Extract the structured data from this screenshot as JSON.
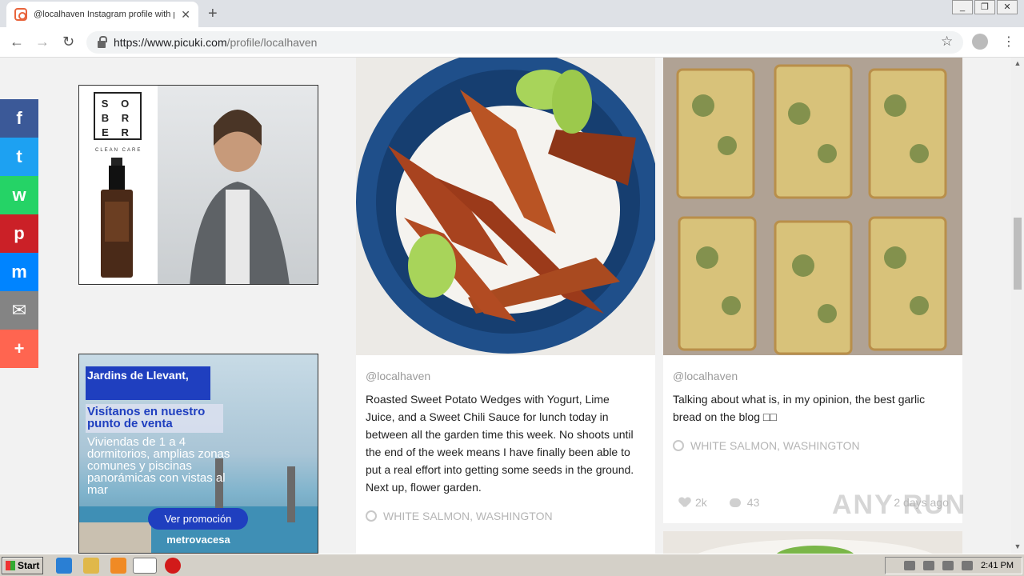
{
  "browser": {
    "tab_title": "@localhaven Instagram profile with p",
    "tab_close": "✕",
    "new_tab": "+",
    "url_host": "https://www.picuki.com",
    "url_path": "/profile/localhaven",
    "back": "←",
    "forward": "→",
    "reload": "↻",
    "star": "☆",
    "menu": "⋮",
    "win_min": "_",
    "win_restore": "❐",
    "win_close": "✕"
  },
  "share": {
    "items": [
      {
        "name": "facebook",
        "glyph": "f",
        "color": "#3b5998"
      },
      {
        "name": "twitter",
        "glyph": "t",
        "color": "#1da1f2"
      },
      {
        "name": "whatsapp",
        "glyph": "w",
        "color": "#25d366"
      },
      {
        "name": "pinterest",
        "glyph": "p",
        "color": "#cb2027"
      },
      {
        "name": "messenger",
        "glyph": "m",
        "color": "#0084ff"
      },
      {
        "name": "email",
        "glyph": "✉",
        "color": "#848484"
      },
      {
        "name": "more",
        "glyph": "+",
        "color": "#ff6550"
      }
    ]
  },
  "ad1": {
    "logo": "SOBER",
    "tagline": "CLEAN CARE"
  },
  "ad2": {
    "headline": "Jardins de Llevant,",
    "subheadline": "Visítanos en nuestro punto de venta",
    "description": "Viviendas de 1 a 4 dormitorios, amplias zonas comunes y piscinas panorámicas con vistas al mar",
    "cta": "Ver promoción",
    "brand": "metrovacesa"
  },
  "posts": [
    {
      "user": "@localhaven",
      "caption": "Roasted Sweet Potato Wedges with Yogurt, Lime Juice, and a Sweet Chili Sauce for lunch today in between all the garden time this week. No shoots until the end of the week means I have finally been able to put a real effort into getting some seeds in the ground. Next up, flower garden.",
      "location": "WHITE SALMON, WASHINGTON"
    },
    {
      "user": "@localhaven",
      "caption": "Talking about what is, in my opinion, the best garlic bread on the blog □□",
      "location": "WHITE SALMON, WASHINGTON",
      "likes": "2k",
      "comments": "43",
      "time": "2 days ago"
    }
  ],
  "watermark": "ANY RUN",
  "taskbar": {
    "start": "Start",
    "clock": "2:41 PM"
  }
}
